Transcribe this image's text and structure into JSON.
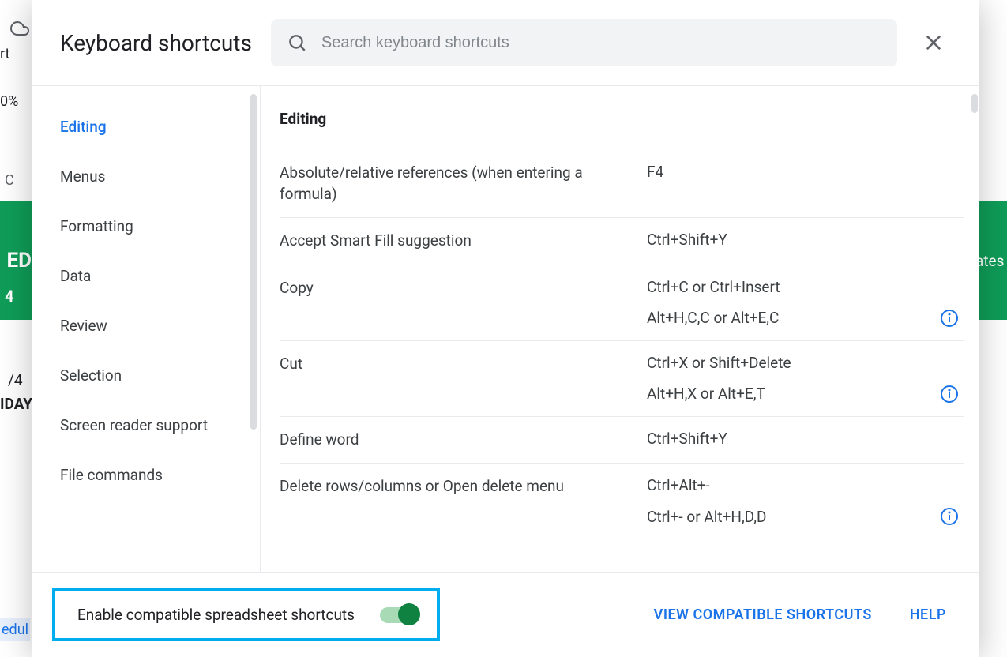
{
  "bg": {
    "rt": "rt",
    "zoom": "0%",
    "c": "C",
    "green": "ED",
    "green_num": "4",
    "green_right": "ates",
    "frac": "/4",
    "day": "IDAY",
    "edul": "edul"
  },
  "dialog": {
    "title": "Keyboard shortcuts",
    "search_placeholder": "Search keyboard shortcuts"
  },
  "sidebar": {
    "items": [
      {
        "label": "Editing",
        "active": true
      },
      {
        "label": "Menus",
        "active": false
      },
      {
        "label": "Formatting",
        "active": false
      },
      {
        "label": "Data",
        "active": false
      },
      {
        "label": "Review",
        "active": false
      },
      {
        "label": "Selection",
        "active": false
      },
      {
        "label": "Screen reader support",
        "active": false
      },
      {
        "label": "File commands",
        "active": false
      }
    ]
  },
  "section": {
    "title": "Editing",
    "rows": [
      {
        "desc": "Absolute/relative references (when entering a formula)",
        "keys": [
          "F4"
        ],
        "info": [
          false
        ]
      },
      {
        "desc": "Accept Smart Fill suggestion",
        "keys": [
          "Ctrl+Shift+Y"
        ],
        "info": [
          false
        ]
      },
      {
        "desc": "Copy",
        "keys": [
          "Ctrl+C or Ctrl+Insert",
          "Alt+H,C,C or Alt+E,C"
        ],
        "info": [
          false,
          true
        ]
      },
      {
        "desc": "Cut",
        "keys": [
          "Ctrl+X or Shift+Delete",
          "Alt+H,X or Alt+E,T"
        ],
        "info": [
          false,
          true
        ]
      },
      {
        "desc": "Define word",
        "keys": [
          "Ctrl+Shift+Y"
        ],
        "info": [
          false
        ]
      },
      {
        "desc": "Delete rows/columns or Open delete menu",
        "keys": [
          "Ctrl+Alt+-",
          "Ctrl+- or Alt+H,D,D"
        ],
        "info": [
          false,
          true
        ]
      }
    ]
  },
  "footer": {
    "toggle_label": "Enable compatible spreadsheet shortcuts",
    "toggle_on": true,
    "view_link": "VIEW COMPATIBLE SHORTCUTS",
    "help_link": "HELP"
  }
}
